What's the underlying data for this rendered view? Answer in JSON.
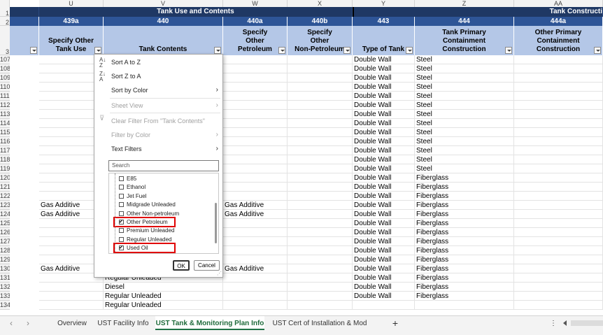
{
  "columns": {
    "letters": [
      "U",
      "V",
      "W",
      "X",
      "Y",
      "Z",
      "AA"
    ],
    "band_title_left": "Tank Use and Contents",
    "band_title_right": "Tank Constructi",
    "codes": [
      "439a",
      "440",
      "440a",
      "440b",
      "443",
      "444",
      "444a"
    ],
    "headers": [
      "Specify Other\nTank Use",
      "Tank Contents",
      "Specify\nOther\nPetroleum",
      "Specify\nOther\nNon-Petroleum",
      "Type of Tank",
      "Tank Primary\nContainment\nConstruction",
      "Other Primary\nContainment\nConstruction"
    ]
  },
  "row_numbers": [
    "107",
    "108",
    "109",
    "110",
    "111",
    "112",
    "113",
    "114",
    "115",
    "116",
    "117",
    "118",
    "119",
    "120",
    "121",
    "122",
    "123",
    "124",
    "125",
    "126",
    "127",
    "128",
    "129",
    "130",
    "131",
    "132",
    "133",
    "134"
  ],
  "cells": {
    "U": {
      "123": "Gas Additive",
      "124": "Gas Additive",
      "130": "Gas Additive"
    },
    "V": {
      "131": "Regular Unleaded",
      "132": "Diesel",
      "133": "Regular Unleaded",
      "134": "Regular Unleaded"
    },
    "W": {
      "123": "Gas Additive",
      "124": "Gas Additive",
      "130": "Gas Additive"
    },
    "Y_value": "Double Wall",
    "Y_rows": [
      "107",
      "108",
      "109",
      "110",
      "111",
      "112",
      "113",
      "114",
      "115",
      "116",
      "117",
      "118",
      "119",
      "120",
      "121",
      "122",
      "123",
      "124",
      "125",
      "126",
      "127",
      "128",
      "129",
      "130",
      "131",
      "132",
      "133"
    ],
    "Z": {
      "107": "Steel",
      "108": "Steel",
      "109": "Steel",
      "110": "Steel",
      "111": "Steel",
      "112": "Steel",
      "113": "Steel",
      "114": "Steel",
      "115": "Steel",
      "116": "Steel",
      "117": "Steel",
      "118": "Steel",
      "119": "Steel",
      "120": "Fiberglass",
      "121": "Fiberglass",
      "122": "Fiberglass",
      "123": "Fiberglass",
      "124": "Fiberglass",
      "125": "Fiberglass",
      "126": "Fiberglass",
      "127": "Fiberglass",
      "128": "Fiberglass",
      "129": "Fiberglass",
      "130": "Fiberglass",
      "131": "Fiberglass",
      "132": "Fiberglass",
      "133": "Fiberglass"
    }
  },
  "filter_menu": {
    "sort_az": "Sort A to Z",
    "sort_za": "Sort Z to A",
    "sort_by_color": "Sort by Color",
    "sheet_view": "Sheet View",
    "clear_filter": "Clear Filter From \"Tank Contents\"",
    "filter_by_color": "Filter by Color",
    "text_filters": "Text Filters",
    "search_placeholder": "Search",
    "items": [
      {
        "label": "E85",
        "checked": false
      },
      {
        "label": "Ethanol",
        "checked": false
      },
      {
        "label": "Jet Fuel",
        "checked": false
      },
      {
        "label": "Midgrade Unleaded",
        "checked": false
      },
      {
        "label": "Other Non-petroleum",
        "checked": false
      },
      {
        "label": "Other Petroleum",
        "checked": true
      },
      {
        "label": "Premium Unleaded",
        "checked": false
      },
      {
        "label": "Regular Unleaded",
        "checked": false
      },
      {
        "label": "Used Oil",
        "checked": true
      }
    ],
    "ok_label": "OK",
    "cancel_label": "Cancel"
  },
  "tabs": [
    {
      "label": "Overview",
      "active": false
    },
    {
      "label": "UST Facility Info",
      "active": false
    },
    {
      "label": "UST Tank & Monitoring Plan Info",
      "active": true
    },
    {
      "label": "UST Cert of Installation & Mod",
      "active": false
    }
  ],
  "add_sheet_label": "+",
  "more_label": "⋮",
  "colors": {
    "band_dark": "#1f3864",
    "band_mid": "#2e5597",
    "header_fill": "#b4c7e7",
    "highlight": "#e00000",
    "active_tab": "#1e7145"
  }
}
